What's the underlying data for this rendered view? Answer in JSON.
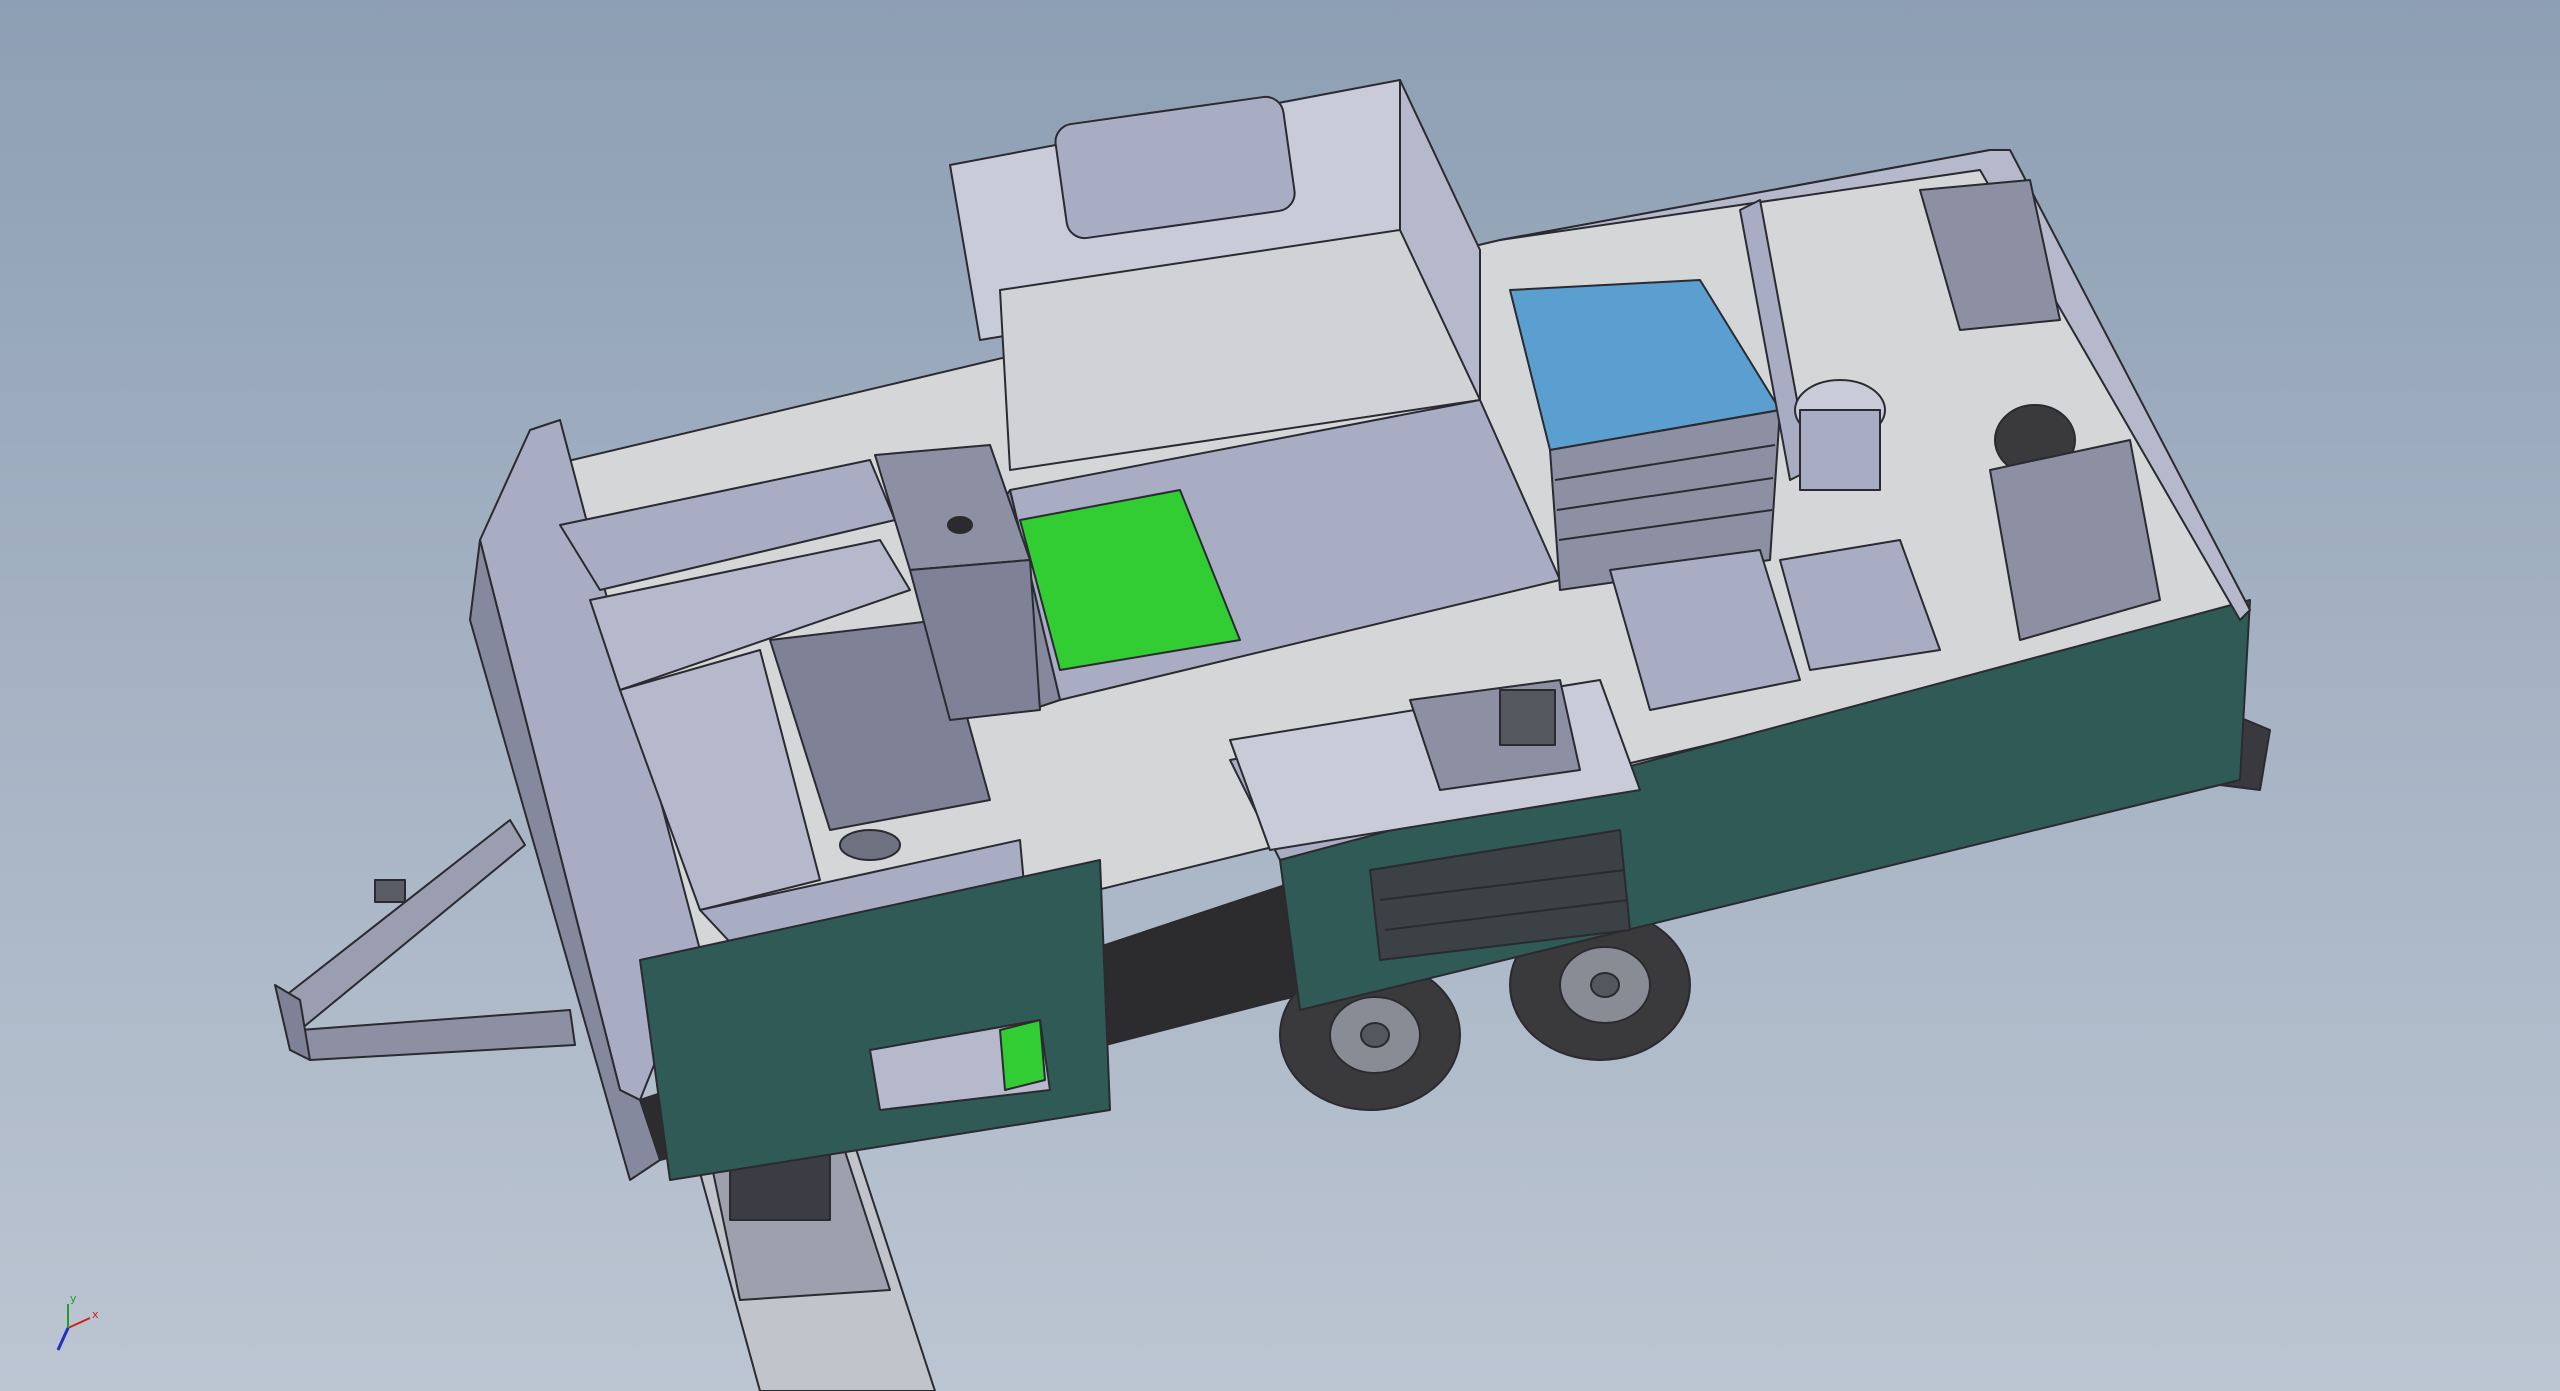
{
  "viewport": {
    "background_top": "#8d9fb4",
    "background_bottom": "#bcc5d2"
  },
  "model": {
    "colors": {
      "wall_light": "#c9ccd8",
      "wall_mid": "#a9adc4",
      "wall_dark": "#85899e",
      "floor": "#d4d6d8",
      "teal": "#2f5a55",
      "teal_dark": "#244845",
      "chassis": "#2c2c2e",
      "green_hatch": "#32cd32",
      "blue_counter": "#5a9fd0",
      "tire": "#3a3a3c",
      "rim": "#8a8c95",
      "edge": "#2a2a30"
    }
  },
  "triad": {
    "x_label": "x",
    "y_label": "y",
    "x_color": "#d02020",
    "y_color": "#20a020",
    "z_color": "#2030c0"
  }
}
